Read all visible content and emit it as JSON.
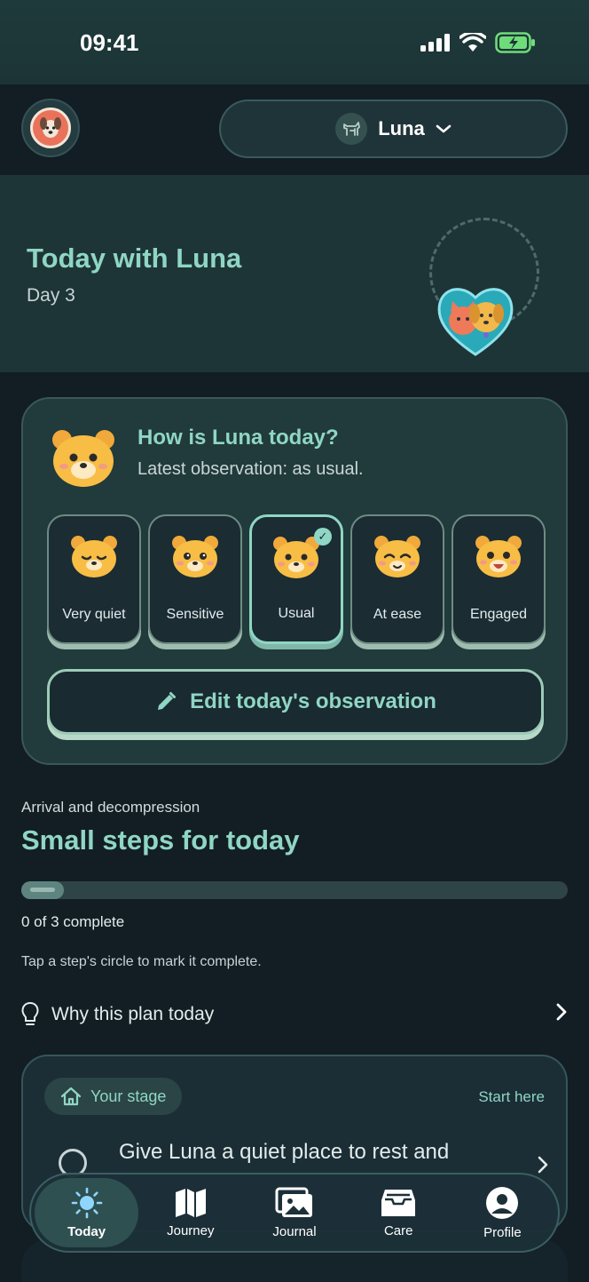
{
  "status_bar": {
    "time": "09:41"
  },
  "top_bar": {
    "pet_name": "Luna"
  },
  "hero": {
    "title": "Today with Luna",
    "day": "Day 3"
  },
  "checkin": {
    "title": "How is Luna today?",
    "subtitle": "Latest observation: as usual.",
    "moods": [
      {
        "label": "Very quiet",
        "selected": false
      },
      {
        "label": "Sensitive",
        "selected": false
      },
      {
        "label": "Usual",
        "selected": true
      },
      {
        "label": "At ease",
        "selected": false
      },
      {
        "label": "Engaged",
        "selected": false
      }
    ],
    "edit_label": "Edit today's observation"
  },
  "steps": {
    "eyebrow": "Arrival and decompression",
    "title": "Small steps for today",
    "completed": 0,
    "total": 3,
    "progress_text": "0 of 3 complete",
    "hint": "Tap a step's circle to mark it complete.",
    "why_label": "Why this plan today"
  },
  "stage_card": {
    "chip_label": "Your stage",
    "start_label": "Start here",
    "task_text": "Give Luna a quiet place to rest and"
  },
  "tabs": [
    {
      "label": "Today",
      "icon": "sun-icon",
      "active": true
    },
    {
      "label": "Journey",
      "icon": "map-icon",
      "active": false
    },
    {
      "label": "Journal",
      "icon": "photos-icon",
      "active": false
    },
    {
      "label": "Care",
      "icon": "inbox-icon",
      "active": false
    },
    {
      "label": "Profile",
      "icon": "person-icon",
      "active": false
    }
  ],
  "colors": {
    "accent": "#8fd6c4",
    "background": "#131d24",
    "card": "#213a3b"
  }
}
